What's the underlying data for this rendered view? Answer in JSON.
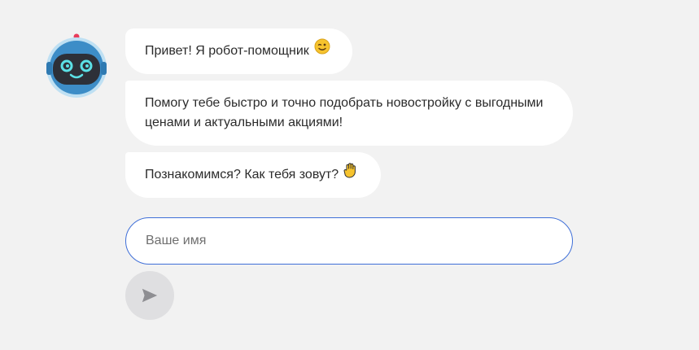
{
  "bot": {
    "avatar_icon": "robot-icon",
    "colors": {
      "head": "#3d8dc7",
      "face": "#2d3038",
      "eyes": "#5ce1e6",
      "antenna_tip": "#e93c5b"
    }
  },
  "messages": [
    {
      "text": "Привет! Я робот-помощник",
      "emoji_icon": "winking-face-icon"
    },
    {
      "text": "Помогу тебе быстро и точно подобрать новостройку с выгодными ценами и актуальными акциями!"
    },
    {
      "text": "Познакомимся? Как тебя зовут?",
      "emoji_icon": "raised-hand-icon"
    }
  ],
  "input": {
    "placeholder": "Ваше имя",
    "value": "",
    "border_color": "#3f6fd8"
  },
  "send": {
    "icon": "send-arrow-icon",
    "background": "#dfdfe1"
  }
}
